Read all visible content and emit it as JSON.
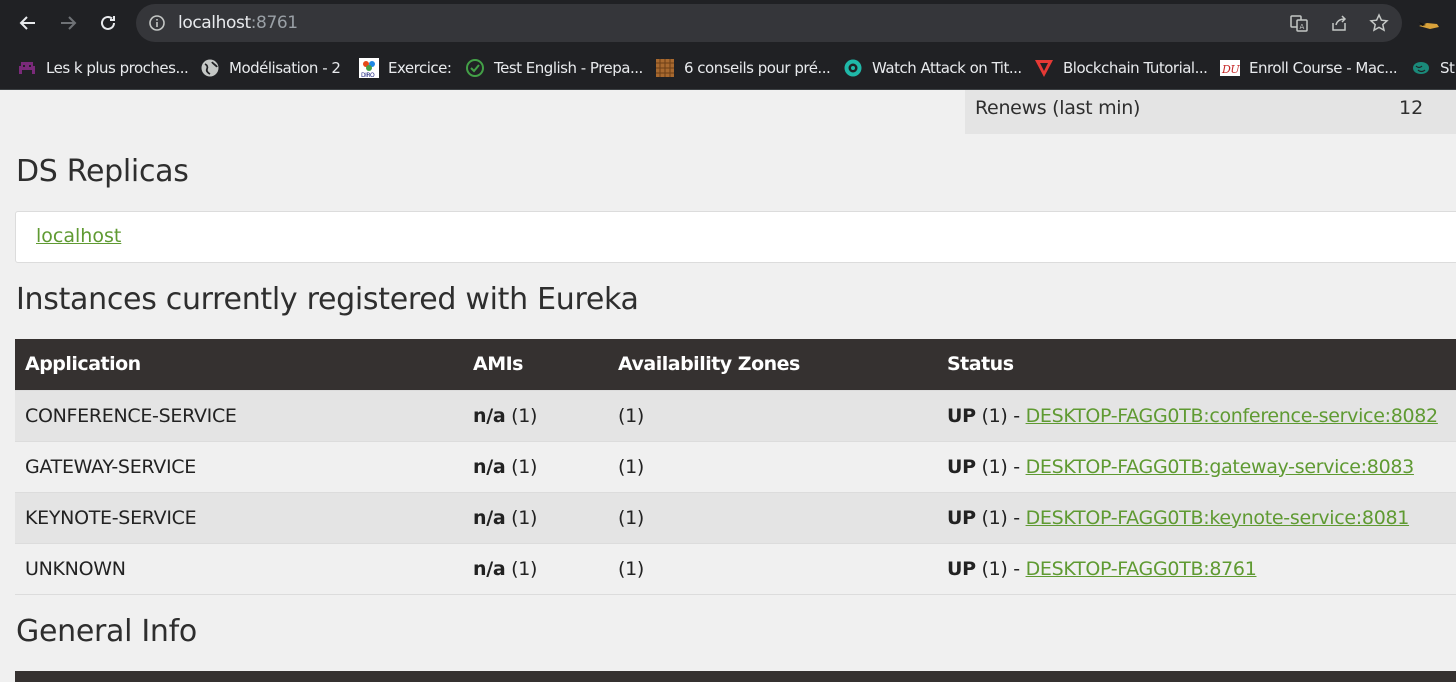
{
  "browser": {
    "url_host": "localhost",
    "url_port": ":8761",
    "bookmarks": [
      {
        "label": "Les k plus proches...",
        "icon": "space-invader-icon"
      },
      {
        "label": "Modélisation - 2",
        "icon": "globe-icon"
      },
      {
        "label": "Exercice:",
        "icon": "diro-icon"
      },
      {
        "label": "Test English - Prepa...",
        "icon": "check-circle-icon"
      },
      {
        "label": "6 conseils pour pré...",
        "icon": "pattern-icon"
      },
      {
        "label": "Watch Attack on Tit...",
        "icon": "play-circle-icon"
      },
      {
        "label": "Blockchain Tutorial...",
        "icon": "triangle-logo-icon"
      },
      {
        "label": "Enroll Course - Mac...",
        "icon": "du-logo-icon"
      },
      {
        "label": "St",
        "icon": "brain-icon"
      }
    ]
  },
  "renews": {
    "label": "Renews (last min)",
    "value": "12"
  },
  "ds_replicas": {
    "title": "DS Replicas",
    "link": "localhost"
  },
  "instances": {
    "title": "Instances currently registered with Eureka",
    "headers": [
      "Application",
      "AMIs",
      "Availability Zones",
      "Status"
    ],
    "rows": [
      {
        "app": "CONFERENCE-SERVICE",
        "amis_bold": "n/a",
        "amis_count": " (1)",
        "zones": "(1)",
        "status_bold": "UP",
        "status_count": " (1) - ",
        "link": "DESKTOP-FAGG0TB:conference-service:8082"
      },
      {
        "app": "GATEWAY-SERVICE",
        "amis_bold": "n/a",
        "amis_count": " (1)",
        "zones": "(1)",
        "status_bold": "UP",
        "status_count": " (1) - ",
        "link": "DESKTOP-FAGG0TB:gateway-service:8083"
      },
      {
        "app": "KEYNOTE-SERVICE",
        "amis_bold": "n/a",
        "amis_count": " (1)",
        "zones": "(1)",
        "status_bold": "UP",
        "status_count": " (1) - ",
        "link": "DESKTOP-FAGG0TB:keynote-service:8081"
      },
      {
        "app": "UNKNOWN",
        "amis_bold": "n/a",
        "amis_count": " (1)",
        "zones": "(1)",
        "status_bold": "UP",
        "status_count": " (1) - ",
        "link": "DESKTOP-FAGG0TB:8761"
      }
    ]
  },
  "general_info": {
    "title": "General Info"
  },
  "colors": {
    "link": "#5f9a32",
    "table_header": "#353130",
    "chrome": "#202124"
  }
}
